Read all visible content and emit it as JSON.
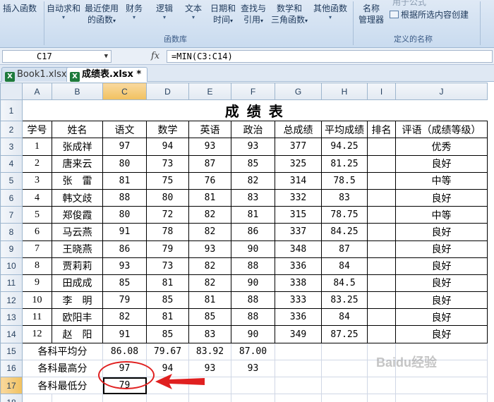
{
  "ribbon": {
    "buttons": {
      "insert_func": "插入函数",
      "autosum": "自动求和",
      "recent": "最近使用",
      "recent2": "的函数",
      "finance": "财务",
      "logic": "逻辑",
      "text": "文本",
      "datetime": "日期和",
      "datetime2": "时间",
      "lookup": "查找与",
      "lookup2": "引用",
      "math": "数学和",
      "math2": "三角函数",
      "other": "其他函数",
      "name_mgr": "名称",
      "name_mgr2": "管理器",
      "use_in_formula": "用于公式",
      "create_from_sel": "根据所选内容创建"
    },
    "groups": {
      "func_lib": "函数库",
      "defined_names": "定义的名称"
    }
  },
  "formula_bar": {
    "name_box": "C17",
    "fx": "fx",
    "formula": "=MIN(C3:C14)"
  },
  "tabs": [
    {
      "label": "Book1.xlsx",
      "active": false
    },
    {
      "label": "成绩表.xlsx *",
      "active": true
    }
  ],
  "sheet": {
    "columns": [
      "A",
      "B",
      "C",
      "D",
      "E",
      "F",
      "G",
      "H",
      "I",
      "J"
    ],
    "title": "成 绩 表",
    "headers": [
      "学号",
      "姓名",
      "语文",
      "数学",
      "英语",
      "政治",
      "总成绩",
      "平均成绩",
      "排名",
      "评语（成绩等级）"
    ],
    "rows": [
      [
        "1",
        "张成祥",
        "97",
        "94",
        "93",
        "93",
        "377",
        "94.25",
        "",
        "优秀"
      ],
      [
        "2",
        "唐来云",
        "80",
        "73",
        "87",
        "85",
        "325",
        "81.25",
        "",
        "良好"
      ],
      [
        "3",
        "张　雷",
        "81",
        "75",
        "76",
        "82",
        "314",
        "78.5",
        "",
        "中等"
      ],
      [
        "4",
        "韩文歧",
        "88",
        "80",
        "81",
        "83",
        "332",
        "83",
        "",
        "良好"
      ],
      [
        "5",
        "郑俊霞",
        "80",
        "72",
        "82",
        "81",
        "315",
        "78.75",
        "",
        "中等"
      ],
      [
        "6",
        "马云燕",
        "91",
        "78",
        "82",
        "86",
        "337",
        "84.25",
        "",
        "良好"
      ],
      [
        "7",
        "王晓燕",
        "86",
        "79",
        "93",
        "90",
        "348",
        "87",
        "",
        "良好"
      ],
      [
        "8",
        "贾莉莉",
        "93",
        "73",
        "82",
        "88",
        "336",
        "84",
        "",
        "良好"
      ],
      [
        "9",
        "田成成",
        "85",
        "81",
        "82",
        "90",
        "338",
        "84.5",
        "",
        "良好"
      ],
      [
        "10",
        "李　明",
        "79",
        "85",
        "81",
        "88",
        "333",
        "83.25",
        "",
        "良好"
      ],
      [
        "11",
        "欧阳丰",
        "82",
        "81",
        "85",
        "88",
        "336",
        "84",
        "",
        "良好"
      ],
      [
        "12",
        "赵　阳",
        "91",
        "85",
        "83",
        "90",
        "349",
        "87.25",
        "",
        "良好"
      ]
    ],
    "avg": {
      "label": "各科平均分",
      "values": [
        "86.08",
        "79.67",
        "83.92",
        "87.00"
      ]
    },
    "max": {
      "label": "各科最高分",
      "values": [
        "97",
        "94",
        "93",
        "93"
      ]
    },
    "min": {
      "label": "各科最低分",
      "value": "79"
    },
    "watermark": "Baidu经验"
  }
}
